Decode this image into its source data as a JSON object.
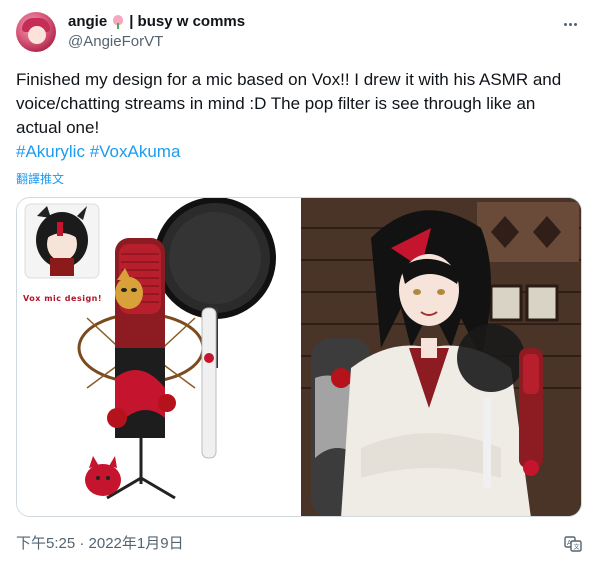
{
  "user": {
    "display_name": "angie",
    "display_name_suffix": "| busy w comms",
    "handle": "@AngieForVT"
  },
  "tweet": {
    "text": "Finished my design for a mic based on Vox!! I drew it with his ASMR and voice/chatting streams in mind :D The pop filter is see through like an actual one!",
    "hashtags": [
      "#Akurylic",
      "#VoxAkuma"
    ],
    "translate_label": "翻譯推文",
    "timestamp": "下午5:25 · 2022年1月9日"
  },
  "media": {
    "left_image_caption": "Vox mic design!",
    "icons": {
      "more": "more-horizontal-icon",
      "translate": "translate-icon",
      "name_badge": "tulip-icon"
    }
  },
  "colors": {
    "link": "#1d9bf0",
    "text": "#0f1419",
    "muted": "#536471",
    "border": "#cfd9de"
  }
}
